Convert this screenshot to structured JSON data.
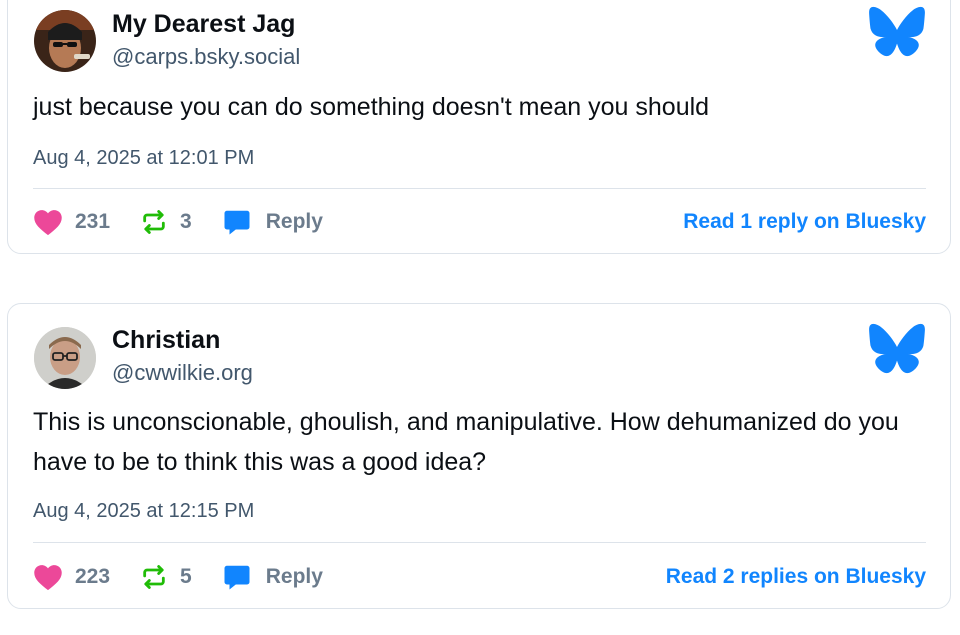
{
  "posts": [
    {
      "author_name": "My Dearest Jag",
      "handle": "@carps.bsky.social",
      "text": "just because you can do something doesn't mean you should",
      "date": "Aug 4, 2025 at 12:01 PM",
      "likes": "231",
      "reposts": "3",
      "reply_label": "Reply",
      "read_link": "Read 1 reply on Bluesky"
    },
    {
      "author_name": "Christian",
      "handle": "@cwwilkie.org",
      "text": "This is unconscionable, ghoulish, and manipulative. How dehumanized do you have to be to think this was a good idea?",
      "date": "Aug 4, 2025 at 12:15 PM",
      "likes": "223",
      "reposts": "5",
      "reply_label": "Reply",
      "read_link": "Read 2 replies on Bluesky"
    }
  ],
  "icons": {
    "like": "heart-icon",
    "repost": "repost-icon",
    "reply": "reply-bubble-icon",
    "brand": "bluesky-butterfly-icon"
  },
  "colors": {
    "brand_blue": "#1185fe",
    "like_pink": "#ec4899",
    "repost_green": "#20bc07",
    "muted_text": "#42576c",
    "border": "#dde3ea"
  }
}
